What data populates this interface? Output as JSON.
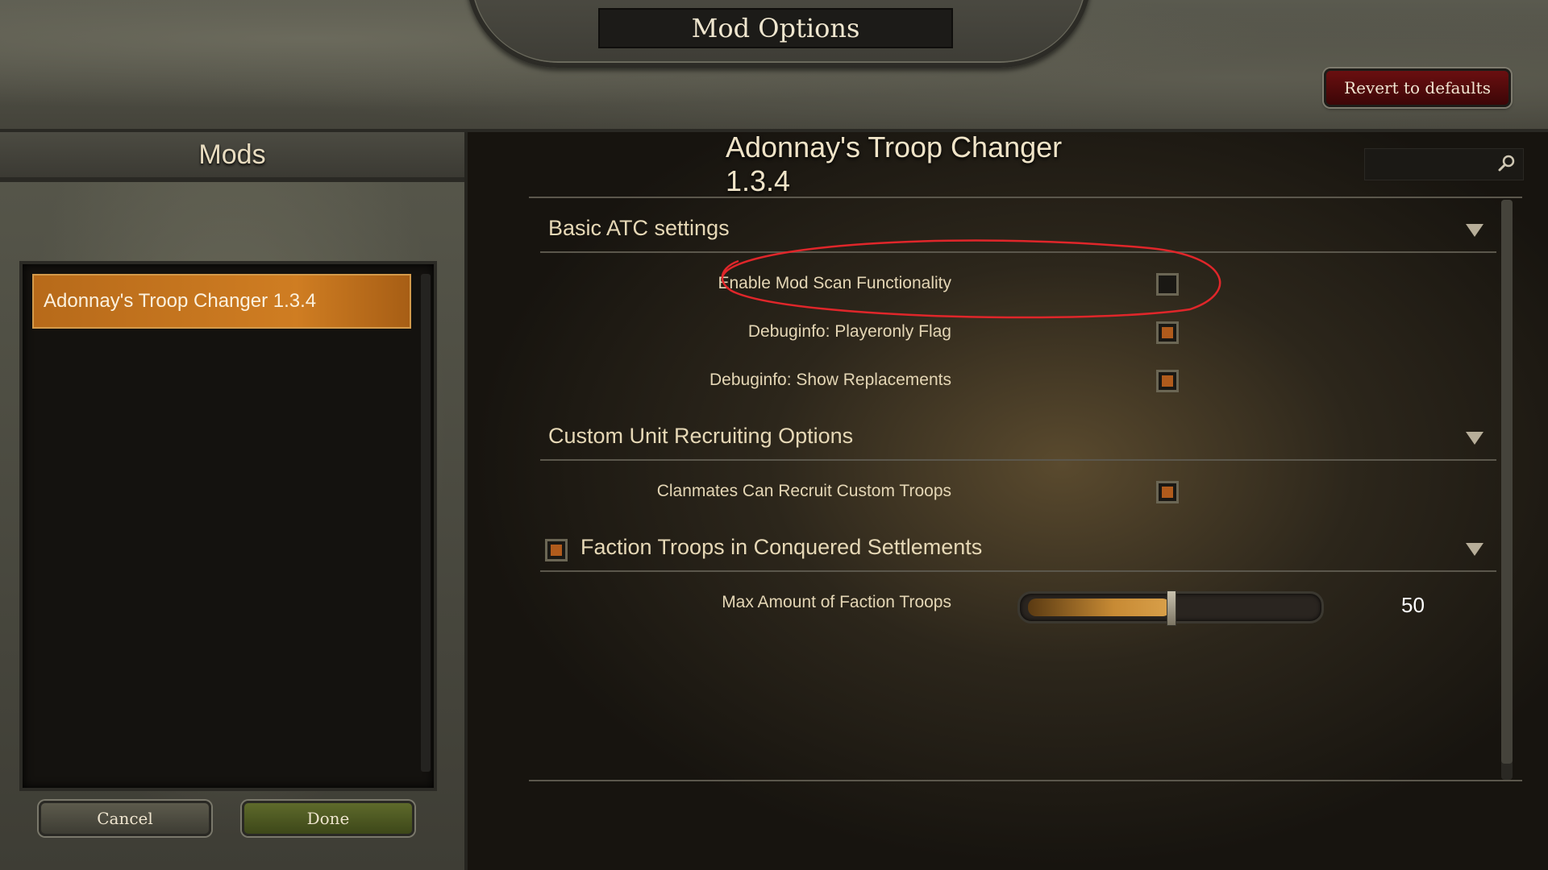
{
  "window": {
    "title": "Mod Options"
  },
  "header": {
    "revert_label": "Revert to defaults"
  },
  "sidebar": {
    "title": "Mods",
    "items": [
      {
        "label": "Adonnay's Troop Changer 1.3.4",
        "selected": true
      }
    ],
    "cancel_label": "Cancel",
    "done_label": "Done"
  },
  "main": {
    "mod_title": "Adonnay's Troop Changer 1.3.4",
    "search": {
      "placeholder": "",
      "icon": "search-icon"
    },
    "sections": [
      {
        "title": "Basic ATC settings",
        "options": [
          {
            "label": "Enable Mod Scan Functionality",
            "checked": false
          },
          {
            "label": "Debuginfo: Playeronly Flag",
            "checked": true
          },
          {
            "label": "Debuginfo: Show Replacements",
            "checked": true
          }
        ]
      },
      {
        "title": "Custom Unit Recruiting Options",
        "options": [
          {
            "label": "Clanmates Can Recruit Custom Troops",
            "checked": true
          }
        ]
      },
      {
        "title": "Faction Troops in Conquered Settlements",
        "header_checked": true,
        "options": [
          {
            "label": "Max Amount of Faction Troops",
            "value": "50",
            "fill_fraction": 0.5
          }
        ]
      }
    ]
  },
  "colors": {
    "accent_orange": "#cf7d22",
    "checkbox_fill": "#b05b1c",
    "revert_red": "#6a0f10",
    "done_green": "#5e6a2b",
    "annotation_red": "#e0262a"
  }
}
